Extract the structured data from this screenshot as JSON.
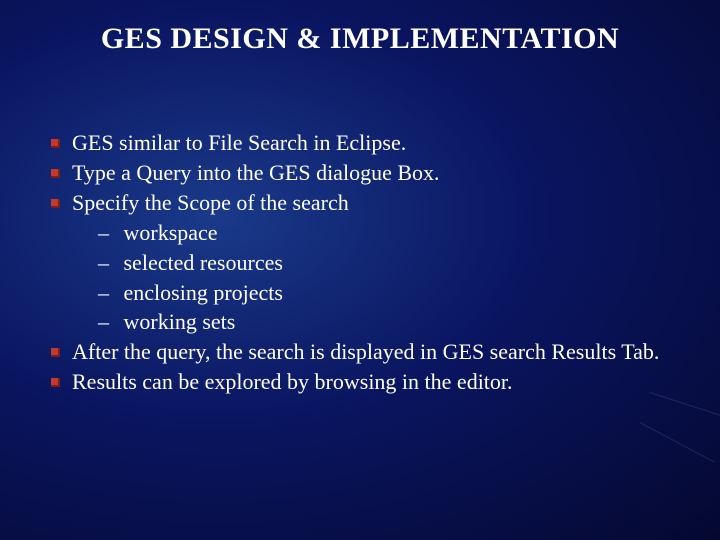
{
  "title": "GES DESIGN & IMPLEMENTATION",
  "bullets": {
    "b0": "GES similar to File Search in Eclipse.",
    "b1": "Type a Query into the GES dialogue Box.",
    "b2": "Specify the Scope of the search",
    "b3": "After the query, the search is displayed in GES search Results Tab.",
    "b4": "Results can be explored by browsing in the editor."
  },
  "sub": {
    "s0": "workspace",
    "s1": "selected resources",
    "s2": "enclosing projects",
    "s3": " working sets"
  },
  "dash": "–"
}
